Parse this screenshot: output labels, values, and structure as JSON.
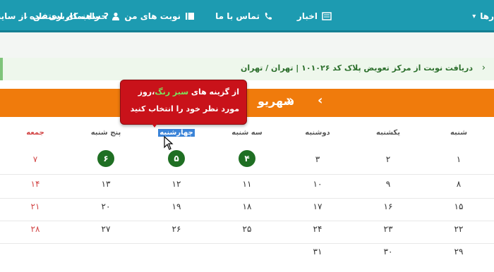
{
  "nav": {
    "help_label": "راهنمای استفاده از سایت",
    "news_label": "اخبار",
    "contact_label": "تماس با ما",
    "appointments_label": "نوبت های من",
    "account_label": "حساب کاربری من",
    "partial_label": "رها"
  },
  "breadcrumb": {
    "text": "دریافت نوبت از مرکز تعویض پلاک کد ۱۰۱۰۲۶ | تهران / تهران"
  },
  "calendar": {
    "month": "شهریو",
    "prev_arrow": "»",
    "next_arrow": "‹",
    "days": [
      "شنبه",
      "یکشنبه",
      "دوشنبه",
      "سه شنبه",
      "چهارشنبه",
      "پنج شنبه",
      "جمعه"
    ],
    "weeks": [
      [
        "۱",
        "۲",
        "۳",
        "۴",
        "۵",
        "۶",
        "۷"
      ],
      [
        "۸",
        "۹",
        "۱۰",
        "۱۱",
        "۱۲",
        "۱۳",
        "۱۴"
      ],
      [
        "۱۵",
        "۱۶",
        "۱۷",
        "۱۸",
        "۱۹",
        "۲۰",
        "۲۱"
      ],
      [
        "۲۲",
        "۲۳",
        "۲۴",
        "۲۵",
        "۲۶",
        "۲۷",
        "۲۸"
      ],
      [
        "۲۹",
        "۳۰",
        "۳۱",
        "",
        "",
        "",
        ""
      ]
    ],
    "available_days": [
      "۴",
      "۵",
      "۶"
    ]
  },
  "tooltip": {
    "l1_pre": "از گزینه های ",
    "l1_green": "سبز رنگ",
    "l1_post": "،روز",
    "line2": "مورد نظر خود را انتخاب کنید"
  },
  "colors": {
    "nav": "#1d9bb1",
    "orange": "#f07b0c",
    "available": "#1f6f23",
    "tooltip": "#c9121a",
    "friday": "#d24646"
  }
}
